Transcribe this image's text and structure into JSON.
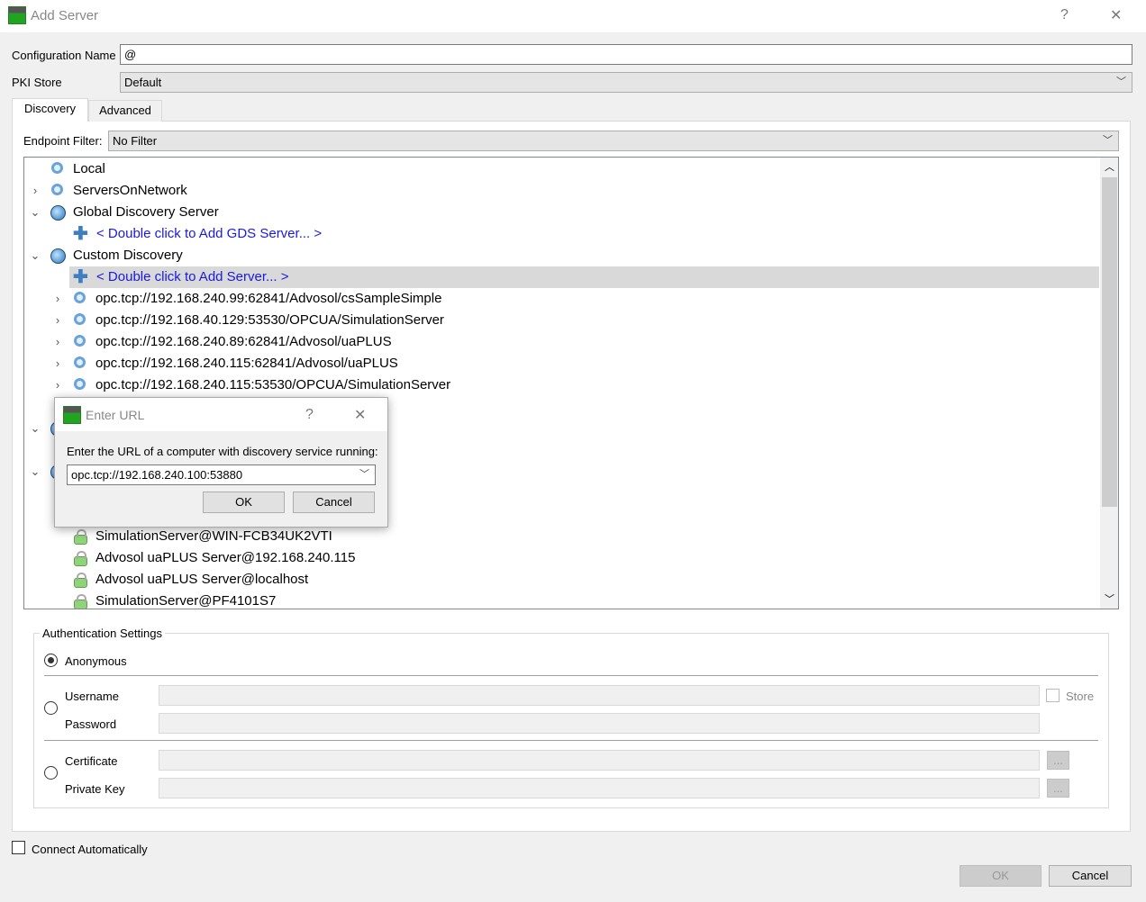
{
  "window": {
    "title": "Add Server",
    "help": "?",
    "close": "✕"
  },
  "form": {
    "config_label": "Configuration Name",
    "config_value": "@",
    "pki_label": "PKI Store",
    "pki_value": "Default"
  },
  "tabs": [
    {
      "label": "Discovery"
    },
    {
      "label": "Advanced"
    }
  ],
  "discovery": {
    "filter_label": "Endpoint Filter:",
    "filter_value": "No Filter"
  },
  "tree": {
    "local": "Local",
    "servers_on_network": "ServersOnNetwork",
    "gds": "Global Discovery Server",
    "gds_add": "< Double click to Add GDS Server... >",
    "custom": "Custom Discovery",
    "custom_add": "< Double click to Add Server... >",
    "urls": [
      "opc.tcp://192.168.240.99:62841/Advosol/csSampleSimple",
      "opc.tcp://192.168.40.129:53530/OPCUA/SimulationServer",
      "opc.tcp://192.168.240.89:62841/Advosol/uaPLUS",
      "opc.tcp://192.168.240.115:62841/Advosol/uaPLUS",
      "opc.tcp://192.168.240.115:53530/OPCUA/SimulationServer"
    ],
    "servers": [
      "SimulationServer@WIN-FCB34UK2VTI",
      "Advosol uaPLUS Server@192.168.240.115",
      "Advosol uaPLUS Server@localhost",
      "SimulationServer@PF4101S7"
    ]
  },
  "dialog": {
    "title": "Enter URL",
    "help": "?",
    "close": "✕",
    "prompt": "Enter the URL of a computer with discovery service running:",
    "url": "opc.tcp://192.168.240.100:53880",
    "ok": "OK",
    "cancel": "Cancel"
  },
  "auth": {
    "title": "Authentication Settings",
    "anonymous": "Anonymous",
    "username": "Username",
    "password": "Password",
    "store": "Store",
    "certificate": "Certificate",
    "private_key": "Private Key",
    "browse": "..."
  },
  "footer": {
    "connect_auto": "Connect Automatically",
    "ok": "OK",
    "cancel": "Cancel"
  }
}
